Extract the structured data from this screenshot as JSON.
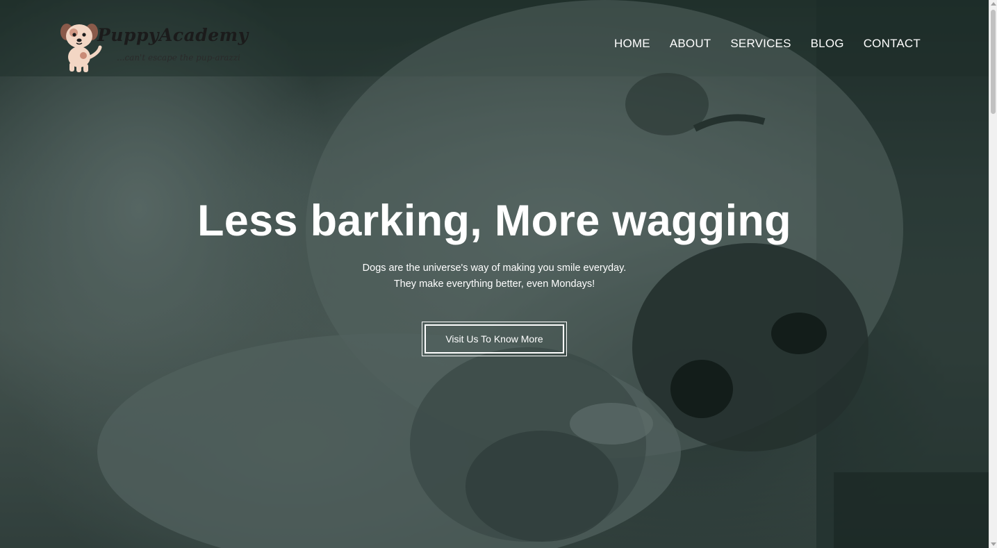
{
  "brand": {
    "name": "PuppyAcademy",
    "tagline": "...can't escape the pup-arazzi",
    "logo_icon": "puppy-icon"
  },
  "nav": {
    "items": [
      {
        "label": "HOME"
      },
      {
        "label": "ABOUT"
      },
      {
        "label": "SERVICES"
      },
      {
        "label": "BLOG"
      },
      {
        "label": "CONTACT"
      }
    ]
  },
  "hero": {
    "title": "Less barking, More wagging",
    "subtitle_line1": "Dogs are the universe's way of making you smile everyday.",
    "subtitle_line2": "They make everything better, even Mondays!",
    "cta_label": "Visit Us To Know More",
    "background_image": "sleeping-dog-photo"
  },
  "colors": {
    "overlay": "#1e3a35",
    "text": "#ffffff",
    "logo_text": "#1b1b1b"
  }
}
